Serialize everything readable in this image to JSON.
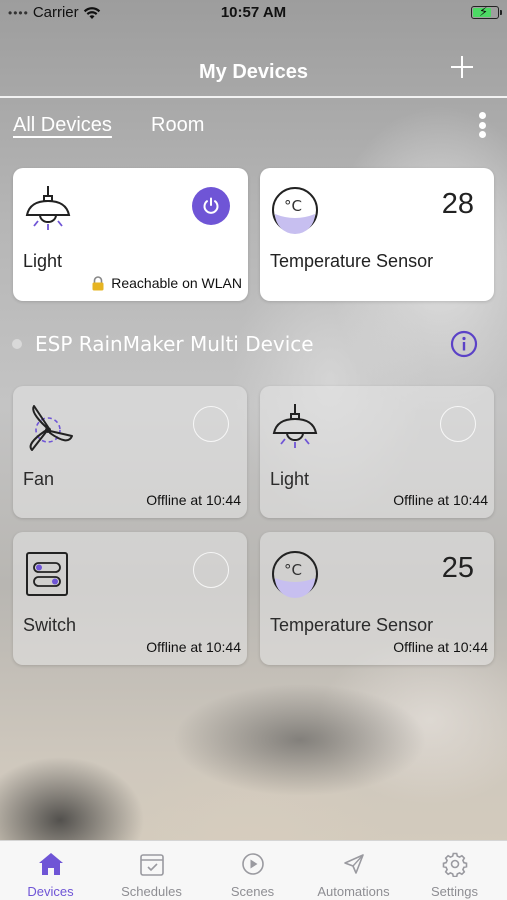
{
  "status_bar": {
    "carrier": "Carrier",
    "time": "10:57 AM"
  },
  "nav": {
    "title": "My Devices"
  },
  "tabs": {
    "all_devices": "All Devices",
    "room": "Room"
  },
  "devices": [
    {
      "name": "Light",
      "status": "Reachable on WLAN",
      "icon": "light-icon",
      "power": "on"
    },
    {
      "name": "Temperature Sensor",
      "value": "28",
      "icon": "temperature-sensor-icon"
    }
  ],
  "group": {
    "title": "ESP RainMaker Multi Device",
    "devices": [
      {
        "name": "Fan",
        "status": "Offline at 10:44",
        "icon": "fan-icon"
      },
      {
        "name": "Light",
        "status": "Offline at 10:44",
        "icon": "light-icon"
      },
      {
        "name": "Switch",
        "status": "Offline at 10:44",
        "icon": "switch-icon"
      },
      {
        "name": "Temperature Sensor",
        "value": "25",
        "status": "Offline at 10:44",
        "icon": "temperature-sensor-icon"
      }
    ]
  },
  "tab_bar": [
    {
      "label": "Devices",
      "icon": "house-icon",
      "active": true
    },
    {
      "label": "Schedules",
      "icon": "calendar-icon"
    },
    {
      "label": "Scenes",
      "icon": "play-icon"
    },
    {
      "label": "Automations",
      "icon": "send-icon"
    },
    {
      "label": "Settings",
      "icon": "gear-icon"
    }
  ],
  "colors": {
    "accent": "#6f55d6",
    "battery": "#4cd964",
    "inactive_tab": "#8e8e93"
  }
}
